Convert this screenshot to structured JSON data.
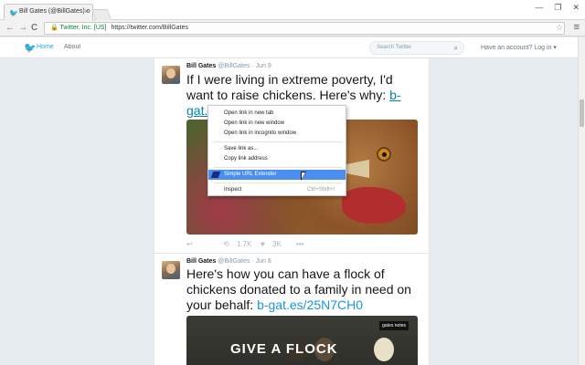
{
  "browser": {
    "tab_title": "Bill Gates (@BillGates) o",
    "tab_close": "×",
    "window_buttons": [
      "—",
      "❐",
      "✕"
    ],
    "nav": {
      "back": "←",
      "forward": "→",
      "reload": "C"
    },
    "url_secure_label": "🔒 Twitter, Inc. [US]",
    "url": "https://twitter.com/BillGates",
    "bookmark_star": "☆",
    "menu": "≡"
  },
  "twitter_header": {
    "home_label": "Home",
    "about_label": "About",
    "search_placeholder": "Search Twitter",
    "account_label": "Have an account? Log in ▾"
  },
  "tweets": [
    {
      "name": "Bill Gates",
      "handle": "@BillGates",
      "date": "· Jun 9",
      "text": "If I were living in extreme poverty, I'd want to raise chickens. Here's why:",
      "link_part1": "b-",
      "link_part2": "gat.es/25M...l...4",
      "actions": {
        "reply": "↩",
        "retweet_icon": "⟲",
        "retweet_count": "1.7K",
        "like_icon": "♥",
        "like_count": "3K",
        "more": "•••"
      }
    },
    {
      "name": "Bill Gates",
      "handle": "@BillGates",
      "date": "· Jun 8",
      "text": "Here's how you can have a flock of chickens donated to a family in need on your behalf:",
      "link": "b-gat.es/25N7CH0",
      "image_title": "GIVE A FLOCK",
      "image_brand": "gates notes"
    }
  ],
  "context_menu": {
    "items": [
      {
        "label": "Open link in new tab"
      },
      {
        "label": "Open link in new window"
      },
      {
        "label": "Open link in incognito window"
      },
      {
        "label": "Save link as..."
      },
      {
        "label": "Copy link address"
      },
      {
        "label": "Simple URL Extender"
      },
      {
        "label": "Inspect",
        "shortcut": "Ctrl+Shift+I"
      }
    ]
  }
}
